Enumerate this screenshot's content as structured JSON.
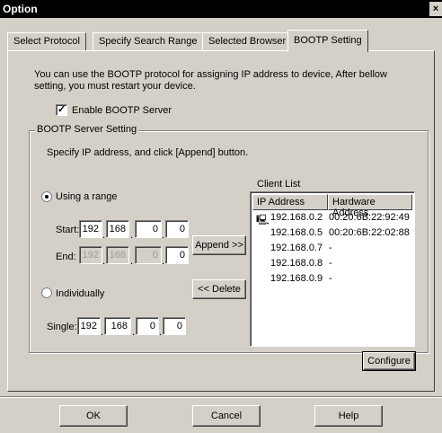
{
  "window": {
    "title": "Option",
    "close_glyph": "×"
  },
  "tabs": [
    {
      "label": "Select Protocol"
    },
    {
      "label": "Specify Search Range"
    },
    {
      "label": "Selected Browser"
    },
    {
      "label": "BOOTP Setting"
    }
  ],
  "active_tab": "BOOTP Setting",
  "description": "You can use the BOOTP protocol for assigning IP address to device, After bellow setting, you must restart your device.",
  "enable_bootp": {
    "label": "Enable BOOTP Server",
    "checked": true
  },
  "server_setting": {
    "legend": "BOOTP Server Setting",
    "instruction": "Specify IP address, and click [Append] button.",
    "range_option": {
      "label": "Using a range",
      "selected": true
    },
    "individual_option": {
      "label": "Individually",
      "selected": false
    },
    "start": {
      "label": "Start:",
      "octets": [
        "192",
        "168",
        "0",
        "0"
      ]
    },
    "end": {
      "label": "End:",
      "octets": [
        "192",
        "168",
        "0",
        "0"
      ]
    },
    "single": {
      "label": "Single:",
      "octets": [
        "192",
        "168",
        "0",
        "0"
      ]
    },
    "append_label": "Append >>",
    "delete_label": "<< Delete",
    "configure_label": "Configure"
  },
  "client_list": {
    "title": "Client List",
    "columns": [
      "IP Address",
      "Hardware Address"
    ],
    "rows": [
      {
        "ip": "192.168.0.2",
        "hw": "00:20:6B:22:92:49",
        "icon": "computer-icon"
      },
      {
        "ip": "192.168.0.5",
        "hw": "00:20:6B:22:02:88"
      },
      {
        "ip": "192.168.0.7",
        "hw": "-"
      },
      {
        "ip": "192.168.0.8",
        "hw": "-"
      },
      {
        "ip": "192.168.0.9",
        "hw": "-"
      }
    ]
  },
  "footer": {
    "ok_label": "OK",
    "cancel_label": "Cancel",
    "help_label": "Help"
  }
}
